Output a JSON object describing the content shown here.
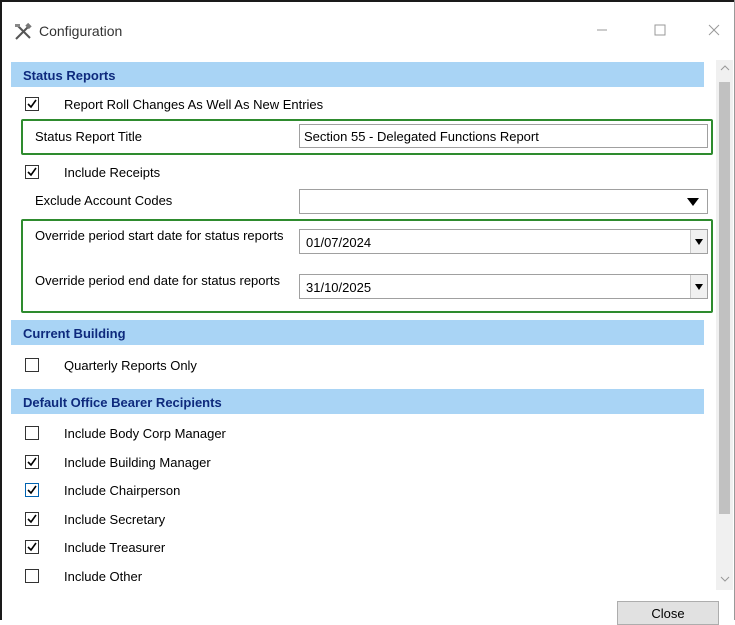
{
  "window": {
    "title": "Configuration",
    "icon": "tools-icon"
  },
  "sections": {
    "status_reports": {
      "header": "Status Reports",
      "roll_changes": {
        "label": "Report Roll Changes As Well As New Entries",
        "checked": true
      },
      "report_title": {
        "label": "Status Report Title",
        "value": "Section 55 - Delegated Functions Report"
      },
      "include_receipts": {
        "label": "Include Receipts",
        "checked": true
      },
      "exclude_account_codes": {
        "label": "Exclude Account Codes",
        "value": ""
      },
      "override_start": {
        "label": "Override period start date for status reports",
        "value": "01/07/2024"
      },
      "override_end": {
        "label": "Override period end date for status reports",
        "value": "31/10/2025"
      }
    },
    "current_building": {
      "header": "Current Building",
      "quarterly_only": {
        "label": "Quarterly Reports Only",
        "checked": false
      }
    },
    "default_recipients": {
      "header": "Default Office Bearer Recipients",
      "items": [
        {
          "label": "Include Body Corp Manager",
          "checked": false
        },
        {
          "label": "Include Building Manager",
          "checked": true
        },
        {
          "label": "Include Chairperson",
          "checked": true
        },
        {
          "label": "Include Secretary",
          "checked": true
        },
        {
          "label": "Include Treasurer",
          "checked": true
        },
        {
          "label": "Include Other",
          "checked": false
        }
      ]
    }
  },
  "buttons": {
    "close_label": "Close"
  },
  "colors": {
    "section_header_bg": "#a9d4f5",
    "section_header_text": "#0e2a7d",
    "highlight_box": "#2e8b2e"
  }
}
